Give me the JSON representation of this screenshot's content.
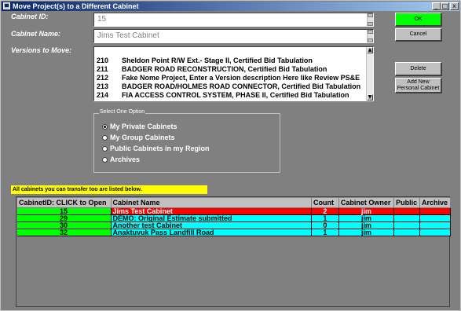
{
  "window": {
    "title": "Move Project(s) to a Different Cabinet",
    "controls": {
      "minimize": "_",
      "maximize": "□",
      "close": "x"
    }
  },
  "form": {
    "cabinet_id_label": "Cabinet ID:",
    "cabinet_id_value": "15",
    "cabinet_name_label": "Cabinet Name:",
    "cabinet_name_value": "Jims Test Cabinet",
    "versions_label": "Versions to Move:"
  },
  "versions": [
    {
      "num": "210",
      "desc": "Sheldon Point R/W Ext.- Stage II,    Certified Bid Tabulation"
    },
    {
      "num": "211",
      "desc": "BADGER ROAD RECONSTRUCTION,    Certified Bid Tabulation"
    },
    {
      "num": "212",
      "desc": "Fake Nome Project,    Enter a Version description Here like Review PS&E"
    },
    {
      "num": "213",
      "desc": "BADGER ROAD/HOLMES ROAD CONNECTOR,    Certified Bid Tabulation"
    },
    {
      "num": "214",
      "desc": "FIA ACCESS CONTROL SYSTEM, PHASE II,    Certified Bid Tabulation"
    }
  ],
  "buttons": {
    "ok": "OK",
    "cancel": "Cancel",
    "delete": "Delete",
    "add_new": "Add New Personal Cabinet"
  },
  "options": {
    "legend": "Select One Option",
    "items": [
      {
        "label": "My Private Cabinets",
        "selected": true
      },
      {
        "label": "My Group Cabinets",
        "selected": false
      },
      {
        "label": "Public Cabinets in my Region",
        "selected": false
      },
      {
        "label": "Archives",
        "selected": false
      }
    ]
  },
  "notice": "All cabinets you can transfer too are listed below.",
  "table": {
    "headers": [
      "CabinetID: CLICK to Open",
      "Cabinet Name",
      "Count",
      "Cabinet Owner",
      "Public",
      "Archive"
    ],
    "rows": [
      {
        "id": "15",
        "name": "Jims Test Cabinet",
        "count": "2",
        "owner": "jim",
        "public": "",
        "archive": "",
        "selected": true
      },
      {
        "id": "29",
        "name": "DEMO: Original Estimate submitted",
        "count": "1",
        "owner": "jim",
        "public": "",
        "archive": "",
        "selected": false
      },
      {
        "id": "30",
        "name": "Another test Cabinet",
        "count": "0",
        "owner": "jim",
        "public": "",
        "archive": "",
        "selected": false
      },
      {
        "id": "32",
        "name": "Anaktuvuk Pass Landfill Road",
        "count": "1",
        "owner": "jim",
        "public": "",
        "archive": "",
        "selected": false
      }
    ]
  },
  "colors": {
    "background": "#808080",
    "title_bar": "#0a246a",
    "ok_button": "#00ff00",
    "selected_row": "#ff0000",
    "normal_row": "#00ffff",
    "id_cell": "#00ff00",
    "notice_bg": "#ffff00"
  }
}
